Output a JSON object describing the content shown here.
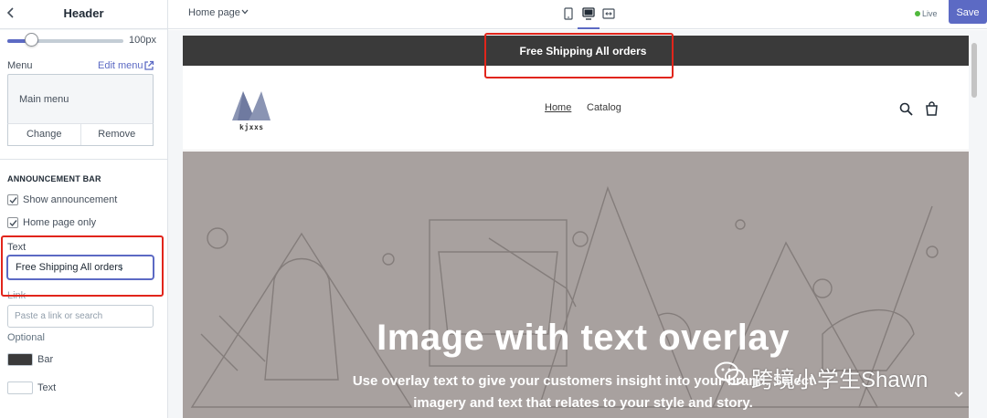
{
  "sidebar": {
    "title": "Header",
    "slider": {
      "value_label": "100px",
      "fraction": 0.27
    },
    "menu": {
      "label": "Menu",
      "edit_label": "Edit menu",
      "current": "Main menu",
      "change_label": "Change",
      "remove_label": "Remove"
    },
    "announcement": {
      "section_title": "ANNOUNCEMENT BAR",
      "show_label": "Show announcement",
      "show_checked": true,
      "home_only_label": "Home page only",
      "home_only_checked": true,
      "text_label": "Text",
      "text_value": "Free Shipping All orders",
      "link_label": "Link",
      "link_placeholder": "Paste a link or search",
      "optional_label": "Optional",
      "bar_color_label": "Bar",
      "bar_color": "#3a3a3a",
      "text_color_label": "Text",
      "text_color": "#ffffff"
    }
  },
  "topbar": {
    "page_select": "Home page",
    "live_label": "Live",
    "save_label": "Save",
    "accent": "#5c6ac4",
    "devices": [
      "mobile-icon",
      "desktop-icon",
      "fullscreen-icon"
    ],
    "active_device": "desktop-icon"
  },
  "preview": {
    "announcement_text": "Free Shipping All orders",
    "logo_text": "kjxxs",
    "nav": [
      "Home",
      "Catalog"
    ],
    "hero_title": "Image with text overlay",
    "hero_sub_line1": "Use overlay text to give your customers insight into your brand. Select",
    "hero_sub_line2": "imagery and text that relates to your style and story."
  },
  "watermark": {
    "text": "跨境小学生Shawn"
  },
  "colors": {
    "highlight": "#e1251b",
    "announcement_bg": "#3a3a3a",
    "hero_bg": "#a8a19f"
  }
}
